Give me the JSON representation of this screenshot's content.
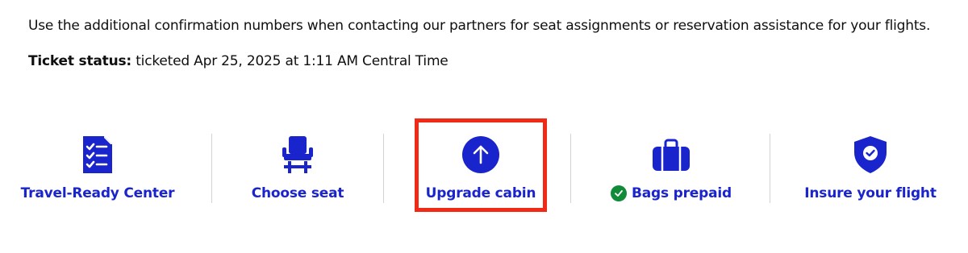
{
  "info": {
    "note": "Use the additional confirmation numbers when contacting our partners for seat assignments or reservation assistance for your flights.",
    "ticket_status_label": "Ticket status:",
    "ticket_status_value": "ticketed Apr 25, 2025 at 1:11 AM Central Time"
  },
  "actions": [
    {
      "label": "Travel-Ready Center",
      "icon": "checklist-document-icon"
    },
    {
      "label": "Choose seat",
      "icon": "seat-icon"
    },
    {
      "label": "Upgrade cabin",
      "icon": "arrow-up-circle-icon",
      "highlighted": true
    },
    {
      "label": "Bags prepaid",
      "icon": "luggage-icon",
      "status_icon": "check-circle-icon"
    },
    {
      "label": "Insure your flight",
      "icon": "shield-check-icon"
    }
  ],
  "colors": {
    "accent": "#1a24cc",
    "highlight_border": "#f02a16",
    "success": "#118a3a",
    "divider": "#d3d3d3"
  }
}
